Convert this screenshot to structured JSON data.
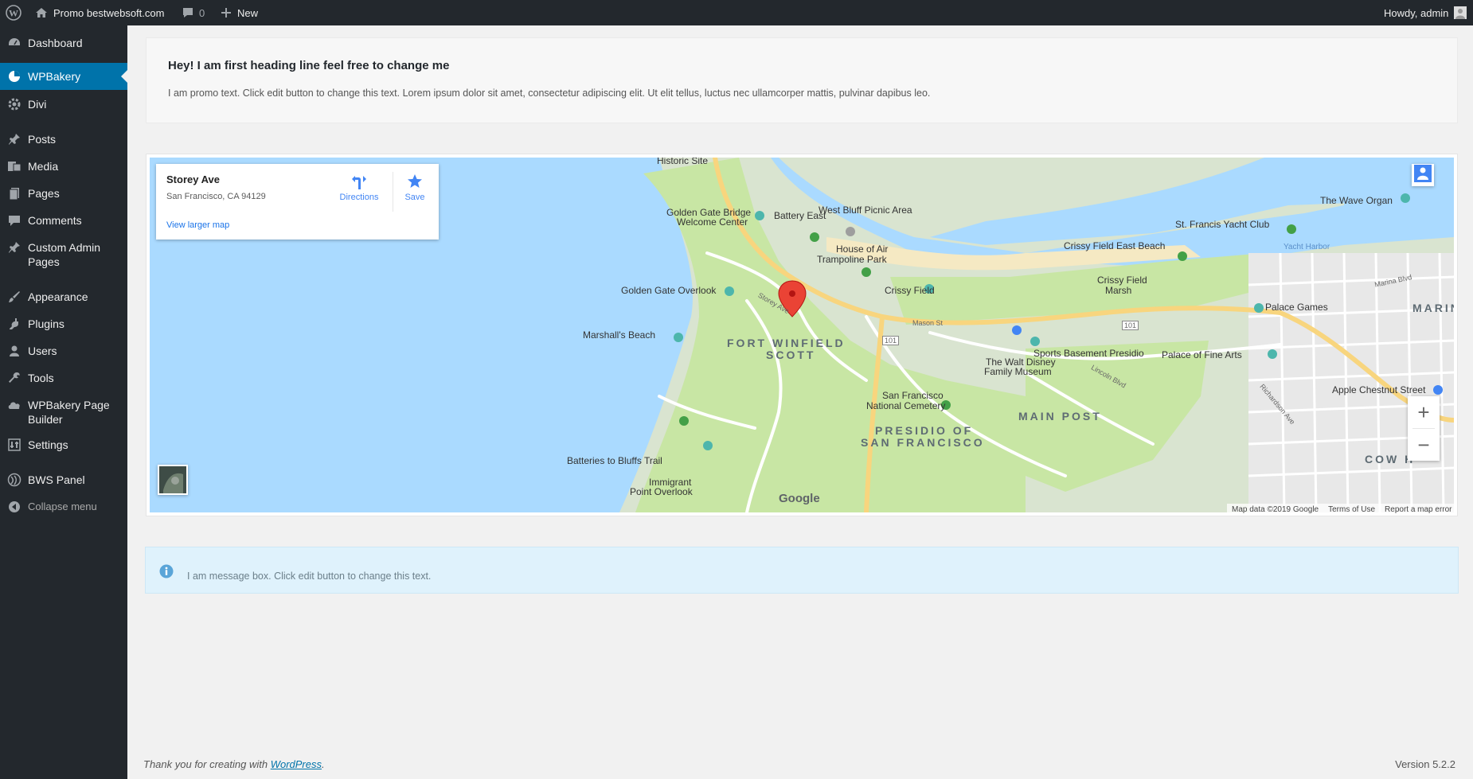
{
  "adminbar": {
    "site_name": "Promo bestwebsoft.com",
    "comments_count": "0",
    "new_label": "New",
    "greeting": "Howdy, admin"
  },
  "sidebar": {
    "items": [
      {
        "label": "Dashboard",
        "icon": "dashboard-icon"
      },
      {
        "label": "WPBakery",
        "icon": "wpbakery-icon",
        "active": true
      },
      {
        "label": "Divi",
        "icon": "gear-icon"
      },
      {
        "label": "Posts",
        "icon": "pin-icon"
      },
      {
        "label": "Media",
        "icon": "media-icon"
      },
      {
        "label": "Pages",
        "icon": "pages-icon"
      },
      {
        "label": "Comments",
        "icon": "comment-icon"
      },
      {
        "label": "Custom Admin Pages",
        "icon": "pin-icon"
      },
      {
        "label": "Appearance",
        "icon": "brush-icon"
      },
      {
        "label": "Plugins",
        "icon": "plug-icon"
      },
      {
        "label": "Users",
        "icon": "user-icon"
      },
      {
        "label": "Tools",
        "icon": "wrench-icon"
      },
      {
        "label": "WPBakery Page Builder",
        "icon": "cloud-icon"
      },
      {
        "label": "Settings",
        "icon": "settings-icon"
      },
      {
        "label": "BWS Panel",
        "icon": "bws-icon"
      },
      {
        "label": "Collapse menu",
        "icon": "collapse-icon"
      }
    ]
  },
  "promo": {
    "heading": "Hey! I am first heading line feel free to change me",
    "text": "I am promo text. Click edit button to change this text. Lorem ipsum dolor sit amet, consectetur adipiscing elit. Ut elit tellus, luctus nec ullamcorper mattis, pulvinar dapibus leo."
  },
  "map": {
    "place_title": "Storey Ave",
    "place_address": "San Francisco, CA 94129",
    "directions_label": "Directions",
    "save_label": "Save",
    "view_larger_label": "View larger map",
    "zoom_in": "+",
    "zoom_out": "−",
    "google_logo": "Google",
    "attribution": {
      "map_data": "Map data ©2019 Google",
      "terms": "Terms of Use",
      "report": "Report a map error"
    },
    "labels": {
      "historic_site": "Historic Site",
      "golden_gate_bridge": "Golden Gate Bridge",
      "welcome_center": "Welcome Center",
      "battery_east": "Battery East",
      "west_bluff": "West Bluff Picnic Area",
      "wave_organ": "The Wave Organ",
      "st_francis": "St. Francis Yacht Club",
      "crissy_east_beach": "Crissy Field East Beach",
      "yacht_harbor": "Yacht Harbor",
      "house_of_air": "House of Air",
      "trampoline_park": "Trampoline Park",
      "golden_gate_overlook": "Golden Gate Overlook",
      "crissy_field": "Crissy Field",
      "crissy_field_marsh": "Crissy Field",
      "crissy_field_marsh2": "Marsh",
      "palace_games": "Palace Games",
      "marina": "MARINA",
      "marshalls_beach": "Marshall's Beach",
      "fort_winfield": "FORT WINFIELD",
      "scott": "SCOTT",
      "sports_basement": "Sports Basement Presidio",
      "palace_fine_arts": "Palace of Fine Arts",
      "walt_disney": "The Walt Disney",
      "family_museum": "Family Museum",
      "apple_chestnut": "Apple Chestnut Street",
      "main_post": "MAIN POST",
      "sf_national": "San Francisco",
      "national_cemetery": "National Cemetery",
      "presidio_of": "PRESIDIO OF",
      "san_francisco": "SAN FRANCISCO",
      "cow_hollow": "COW H",
      "batteries_bluffs": "Batteries to Bluffs Trail",
      "immigrant": "Immigrant",
      "point_overlook": "Point Overlook",
      "marina_blvd": "Marina Blvd",
      "richardson_ave": "Richardson Ave",
      "lincoln_blvd": "Lincoln Blvd",
      "storey_ave": "Storey Ave",
      "mason_st": "Mason St",
      "hwy_101": "101"
    }
  },
  "message": {
    "text": "I am message box. Click edit button to change this text."
  },
  "footer": {
    "thanks": "Thank you for creating with",
    "wordpress": "WordPress",
    "period": ".",
    "version": "Version 5.2.2"
  },
  "colors": {
    "adminbar_bg": "#23282d",
    "active_blue": "#0073aa",
    "water": "#aadaff",
    "park": "#c8e6a4",
    "marker_red": "#ea4335"
  }
}
